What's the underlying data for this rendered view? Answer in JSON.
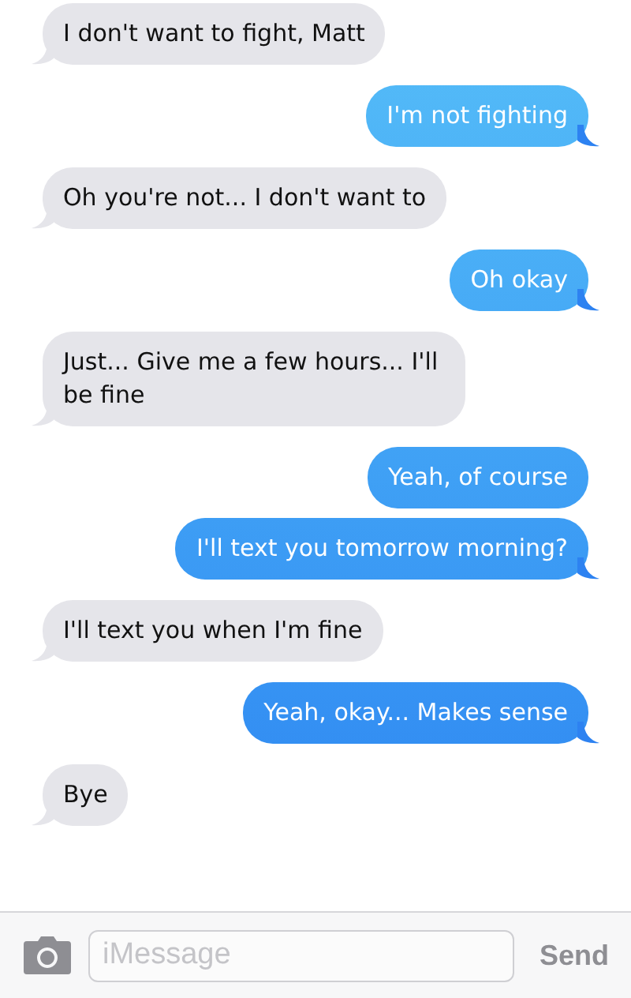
{
  "messages": [
    {
      "kind": "received",
      "text": "I don't want to fight, Matt"
    },
    {
      "kind": "sent",
      "text": "I'm not fighting"
    },
    {
      "kind": "received",
      "text": "Oh you're not... I don't want to"
    },
    {
      "kind": "sent",
      "text": "Oh okay"
    },
    {
      "kind": "received",
      "text": "Just... Give me a few hours... I'll be fine"
    },
    {
      "kind": "sent",
      "text": "Yeah, of course"
    },
    {
      "kind": "sent",
      "text": "I'll text you tomorrow morning?"
    },
    {
      "kind": "received",
      "text": "I'll text you when I'm fine"
    },
    {
      "kind": "sent",
      "text": "Yeah, okay... Makes sense"
    },
    {
      "kind": "received",
      "text": "Bye"
    }
  ],
  "composer": {
    "placeholder": "iMessage",
    "send": "Send"
  }
}
